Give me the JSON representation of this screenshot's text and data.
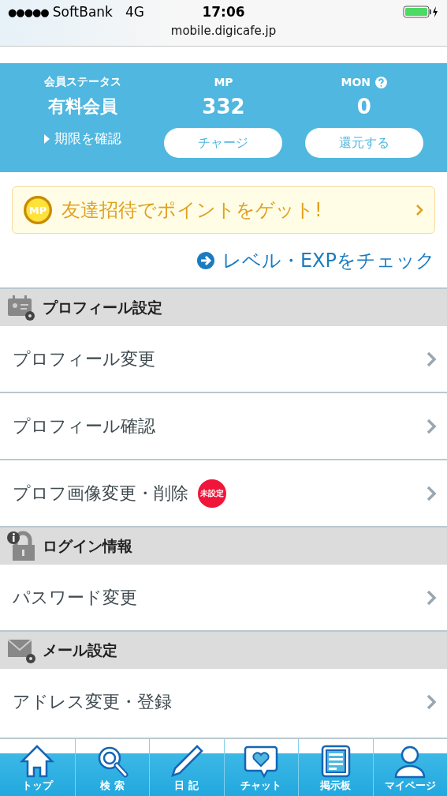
{
  "status_bar": {
    "signal": "●●●●●",
    "carrier": "SoftBank",
    "network": "4G",
    "time": "17:06"
  },
  "address_bar": {
    "url": "mobile.digicafe.jp"
  },
  "summary": {
    "status_label": "会員ステータス",
    "status_value": "有料会員",
    "status_link": "期限を確認",
    "mp_label": "MP",
    "mp_value": "332",
    "mp_button": "チャージ",
    "mon_label": "MON",
    "mon_value": "0",
    "mon_button": "還元する"
  },
  "banner": {
    "coin": "MP",
    "text": "友達招待でポイントをゲット!"
  },
  "level_link": "レベル・EXPをチェック",
  "sections": [
    {
      "title": "プロフィール設定",
      "items": [
        {
          "label": "プロフィール変更"
        },
        {
          "label": "プロフィール確認"
        },
        {
          "label": "プロフ画像変更・削除",
          "badge": "未設定"
        }
      ]
    },
    {
      "title": "ログイン情報",
      "items": [
        {
          "label": "パスワード変更"
        }
      ]
    },
    {
      "title": "メール設定",
      "items": [
        {
          "label": "アドレス変更・登録"
        }
      ]
    }
  ],
  "tab_bar": [
    {
      "label": "トップ"
    },
    {
      "label": "検 索"
    },
    {
      "label": "日 記"
    },
    {
      "label": "チャット"
    },
    {
      "label": "掲示板"
    },
    {
      "label": "マイページ"
    }
  ]
}
